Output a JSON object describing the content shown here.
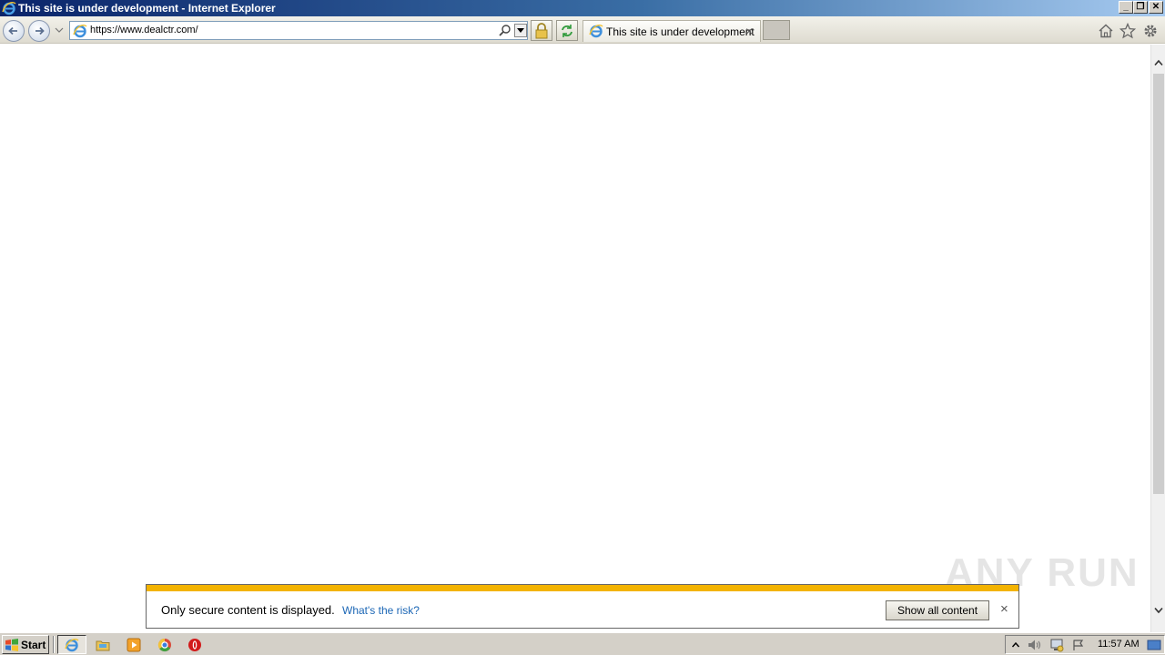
{
  "window": {
    "title": "This site is under development - Internet Explorer"
  },
  "address_bar": {
    "url": "https://www.dealctr.com/"
  },
  "tabs": [
    {
      "label": "This site is under development",
      "active": true
    }
  ],
  "notification": {
    "message": "Only secure content is displayed.",
    "link": "What's the risk?",
    "button": "Show all content",
    "stripe_color": "#f3b300"
  },
  "watermark": {
    "text": "ANY RUN"
  },
  "taskbar": {
    "start_label": "Start",
    "clock": "11:57 AM"
  },
  "icons": {
    "back": "back-arrow-icon",
    "forward": "forward-arrow-icon",
    "home": "home-icon",
    "favorites": "star-icon",
    "tools": "gear-icon",
    "lock": "lock-icon",
    "refresh": "refresh-icon"
  }
}
